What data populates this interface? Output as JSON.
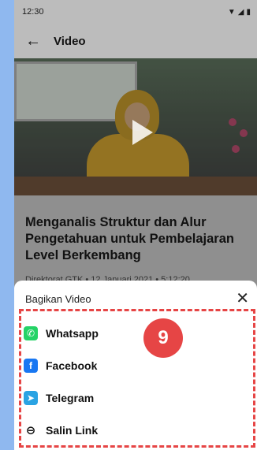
{
  "status_bar": {
    "time": "12:30",
    "icons": [
      "wifi-icon",
      "signal-icon",
      "battery-icon"
    ]
  },
  "app_bar": {
    "title": "Video",
    "back_icon": "back-arrow-icon"
  },
  "video": {
    "title": "Menganalis Struktur dan Alur Pengetahuan untuk Pembelajaran Level Berkembang",
    "meta": "Direktorat GTK • 12 Januari 2021 • 5:12:20"
  },
  "share_sheet": {
    "title": "Bagikan Video",
    "close_icon": "close-icon",
    "items": [
      {
        "label": "Whatsapp",
        "icon": "whatsapp-icon",
        "color": "#25d366"
      },
      {
        "label": "Facebook",
        "icon": "facebook-icon",
        "color": "#1877f2"
      },
      {
        "label": "Telegram",
        "icon": "telegram-icon",
        "color": "#2aa3e3"
      },
      {
        "label": "Salin Link",
        "icon": "link-icon"
      }
    ]
  },
  "annotation": {
    "step_number": "9",
    "color": "#e64545"
  }
}
